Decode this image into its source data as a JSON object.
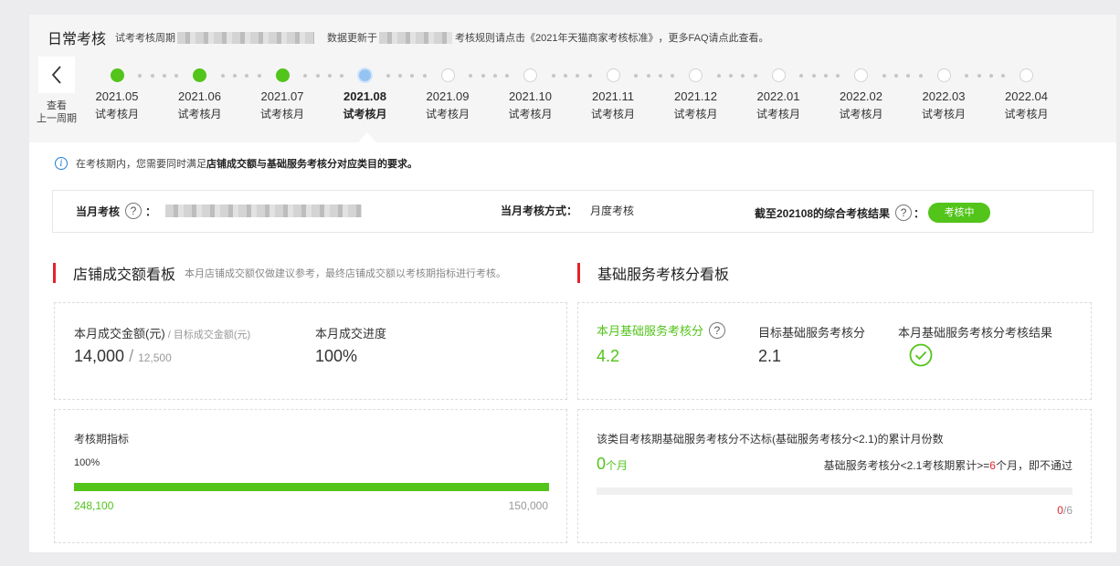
{
  "header": {
    "title": "日常考核",
    "trial_label": "试考考核周期",
    "data_update_label": "数据更新于",
    "rule_prefix": "考核规则请点击",
    "rule_link": "《2021年天猫商家考核标准》",
    "faq_prefix": "，更多FAQ",
    "faq_link": "请点此查看",
    "faq_suffix": "。"
  },
  "nav": {
    "back_line1": "查看",
    "back_line2": "上一周期"
  },
  "timeline": [
    {
      "month": "2021.05",
      "label": "试考核月",
      "state": "done"
    },
    {
      "month": "2021.06",
      "label": "试考核月",
      "state": "done"
    },
    {
      "month": "2021.07",
      "label": "试考核月",
      "state": "done"
    },
    {
      "month": "2021.08",
      "label": "试考核月",
      "state": "current"
    },
    {
      "month": "2021.09",
      "label": "试考核月",
      "state": "future"
    },
    {
      "month": "2021.10",
      "label": "试考核月",
      "state": "future"
    },
    {
      "month": "2021.11",
      "label": "试考核月",
      "state": "future"
    },
    {
      "month": "2021.12",
      "label": "试考核月",
      "state": "future"
    },
    {
      "month": "2022.01",
      "label": "试考核月",
      "state": "future"
    },
    {
      "month": "2022.02",
      "label": "试考核月",
      "state": "future"
    },
    {
      "month": "2022.03",
      "label": "试考核月",
      "state": "future"
    },
    {
      "month": "2022.04",
      "label": "试考核月",
      "state": "future"
    }
  ],
  "notice": {
    "prefix": "在考核期内，您需要同时满足",
    "bold": "店铺成交额与基础服务考核分对应类目的要求。"
  },
  "summary": {
    "month_assess_label": "当月考核",
    "colon": "：",
    "method_label": "当月考核方式：",
    "method_value": "月度考核",
    "result_label": "截至202108的综合考核结果",
    "result_badge": "考核中"
  },
  "store": {
    "section_title": "店铺成交额看板",
    "section_note": "本月店铺成交额仅做建议参考，最终店铺成交额以考核期指标进行考核。",
    "amount_label": "本月成交金额(元)",
    "target_label": " / 目标成交金额(元)",
    "amount_value": "14,000",
    "slash": " / ",
    "target_value": "12,500",
    "progress_label": "本月成交进度",
    "progress_value": "100%",
    "period_label": "考核期指标",
    "period_percent": "100%",
    "period_progress": 1.0,
    "period_current": "248,100",
    "period_target": "150,000"
  },
  "service": {
    "section_title": "基础服务考核分看板",
    "score_label": "本月基础服务考核分",
    "score_value": "4.2",
    "target_label": "目标基础服务考核分",
    "target_value": "2.1",
    "result_label": "本月基础服务考核分考核结果",
    "fail_desc": "该类目考核期基础服务考核分不达标(基础服务考核分<2.1)的累计月份数",
    "fail_count": "0",
    "fail_unit": "个月",
    "rule_prefix": "基础服务考核分<2.1考核期累计>=",
    "rule_num": "6",
    "rule_suffix": "个月，即不通过",
    "count_current": "0",
    "count_sep": "/",
    "count_total": "6",
    "count_progress": 0
  },
  "colors": {
    "green": "#52c41a",
    "red": "#e0242d",
    "link": "#1f7fd8"
  }
}
